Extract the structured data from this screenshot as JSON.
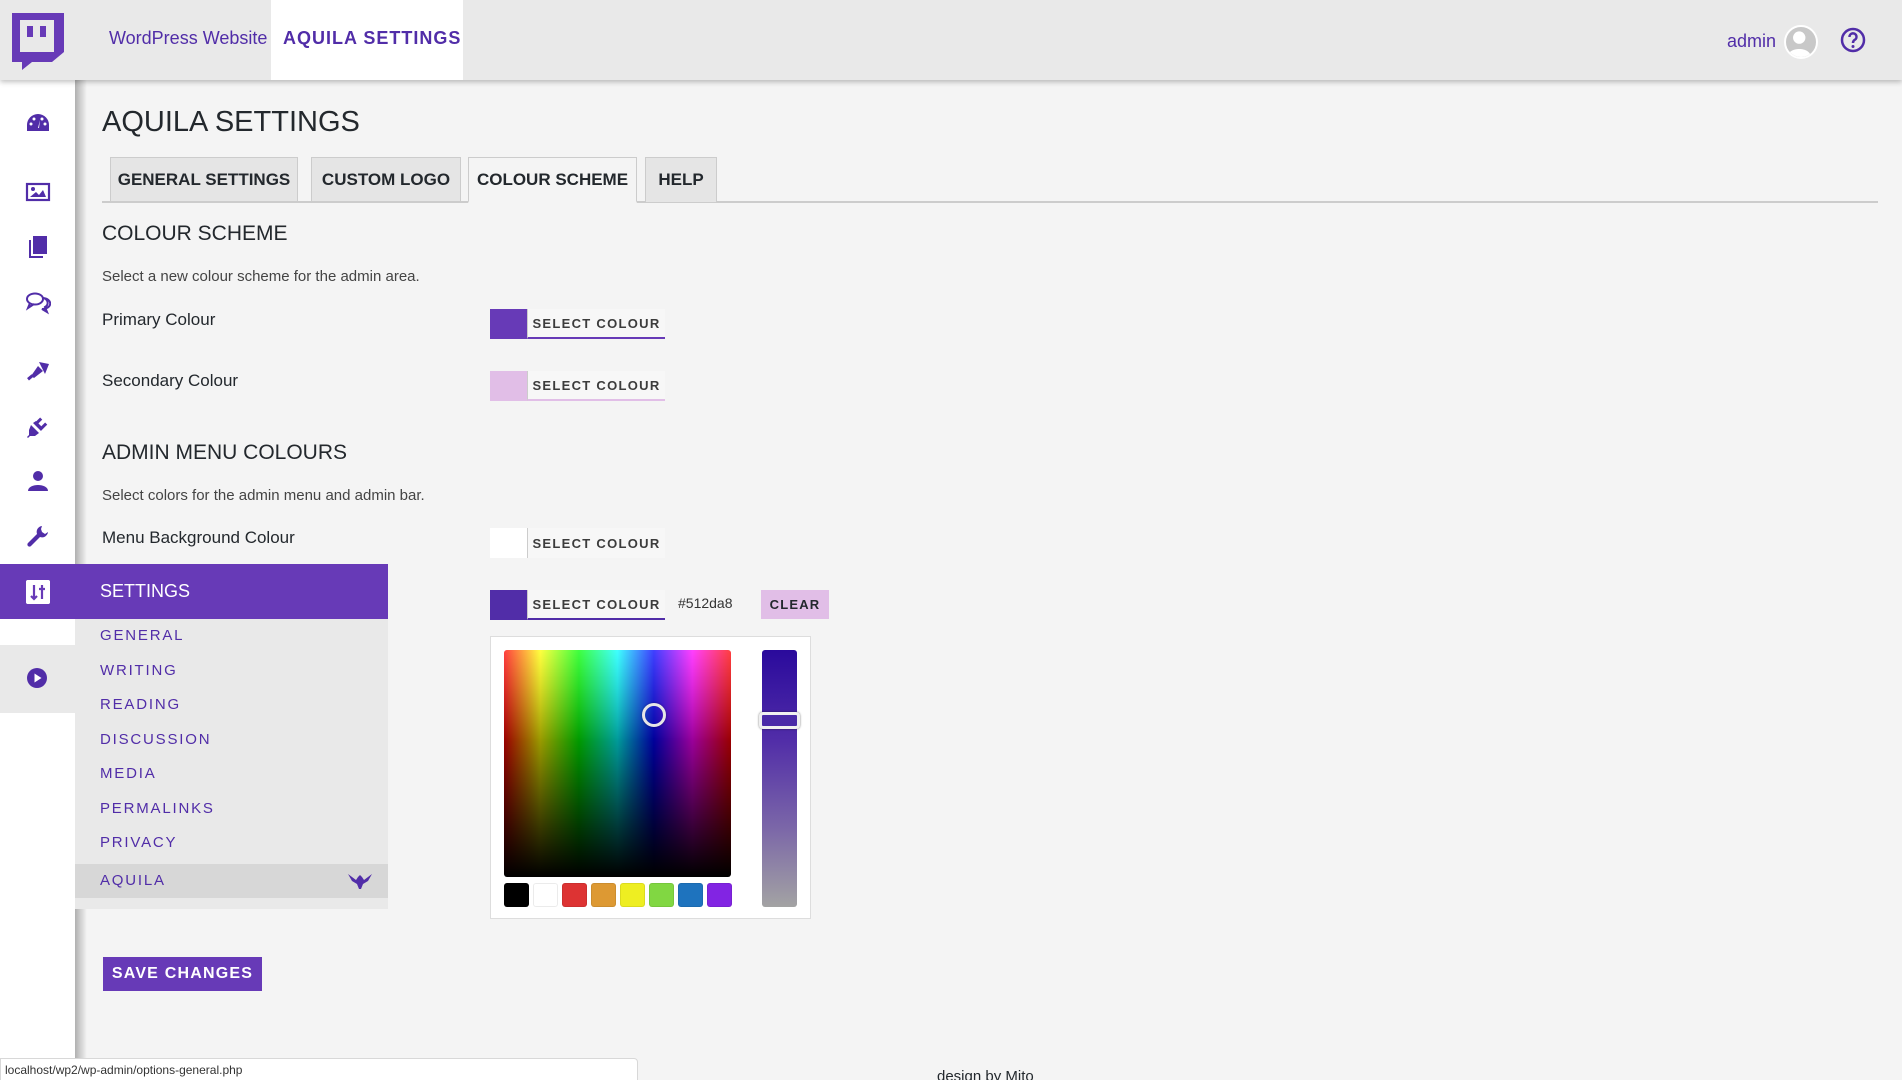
{
  "topbar": {
    "site_name": "WordPress Website",
    "current_page": "AQUILA SETTINGS",
    "user_name": "admin",
    "brand_color": "#512da8"
  },
  "sidebar": {
    "icons": [
      "dashboard-icon",
      "media-icon",
      "pages-icon",
      "comments-icon",
      "appearance-icon",
      "plugins-icon",
      "users-icon",
      "tools-icon",
      "settings-icon",
      "play-icon"
    ],
    "settings_label": "SETTINGS",
    "submenu": [
      {
        "label": "GENERAL",
        "active": false
      },
      {
        "label": "WRITING",
        "active": false
      },
      {
        "label": "READING",
        "active": false
      },
      {
        "label": "DISCUSSION",
        "active": false
      },
      {
        "label": "MEDIA",
        "active": false
      },
      {
        "label": "PERMALINKS",
        "active": false
      },
      {
        "label": "PRIVACY",
        "active": false
      },
      {
        "label": "AQUILA",
        "active": true
      }
    ]
  },
  "main": {
    "title": "AQUILA SETTINGS",
    "tabs": [
      {
        "label": "GENERAL SETTINGS",
        "active": false
      },
      {
        "label": "CUSTOM LOGO",
        "active": false
      },
      {
        "label": "COLOUR SCHEME",
        "active": true
      },
      {
        "label": "HELP",
        "active": false
      }
    ],
    "colour_scheme": {
      "heading": "COLOUR SCHEME",
      "description": "Select a new colour scheme for the admin area.",
      "fields": [
        {
          "label": "Primary Colour",
          "button": "SELECT COLOUR",
          "color": "#673ab7"
        },
        {
          "label": "Secondary Colour",
          "button": "SELECT COLOUR",
          "color": "#e1bee7"
        }
      ]
    },
    "admin_menu": {
      "heading": "ADMIN MENU COLOURS",
      "description": "Select colors for the admin menu and admin bar.",
      "fields": [
        {
          "label": "Menu Background Colour",
          "button": "SELECT COLOUR",
          "color": "#ffffff"
        },
        {
          "label": "",
          "button": "SELECT COLOUR",
          "color": "#512da8",
          "hex_value": "#512da8",
          "clear_label": "CLEAR"
        }
      ]
    },
    "picker": {
      "palette": [
        "#000000",
        "#ffffff",
        "#dd3333",
        "#dd9933",
        "#eeee22",
        "#81d742",
        "#1e73be",
        "#8224e3"
      ]
    },
    "save_label": "SAVE CHANGES"
  },
  "statusbar": {
    "url": "localhost/wp2/wp-admin/options-general.php"
  },
  "footer": {
    "credit": "design by Mito"
  }
}
